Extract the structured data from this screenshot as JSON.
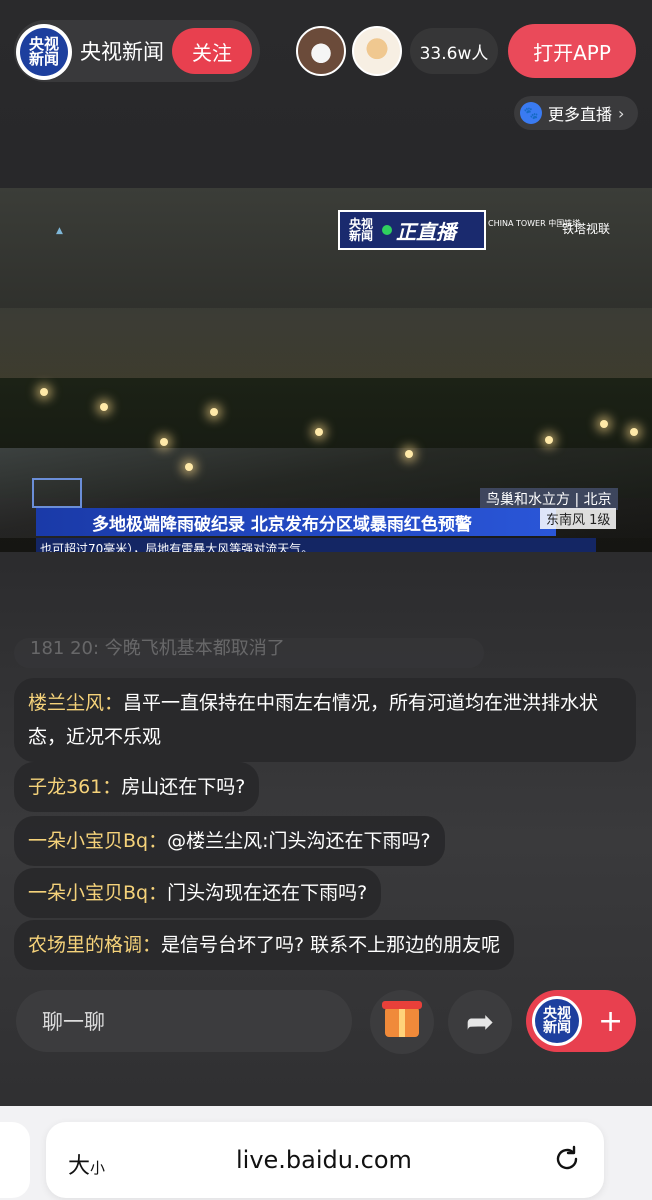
{
  "header": {
    "channel_logo": {
      "line1": "央视",
      "line2": "新闻"
    },
    "channel_name": "央视新闻",
    "follow_label": "关注",
    "viewer_count": "33.6w人",
    "open_app_label": "打开APP",
    "more_live_label": "更多直播"
  },
  "video": {
    "badge_logo": {
      "line1": "央视",
      "line2": "新闻"
    },
    "live_label": "正直播",
    "partner1": "CHINA TOWER 中国铁塔",
    "partner2": "铁塔视联",
    "headline": "多地极端降雨破纪录 北京发布分区域暴雨红色预警",
    "ticker": "也可超过70毫米），局地有雷暴大风等强对流天气。",
    "location": "鸟巢和水立方 | 北京",
    "wind": "东南风 1级"
  },
  "chat": {
    "faded_message": "181  20: 今晚飞机基本都取消了",
    "messages": [
      {
        "user": "楼兰尘风：",
        "text": "昌平一直保持在中雨左右情况，所有河道均在泄洪排水状态，近况不乐观"
      },
      {
        "user": "子龙361：",
        "text": "房山还在下吗?"
      },
      {
        "user": "一朵小宝贝Bq：",
        "text": "@楼兰尘风:门头沟还在下雨吗?"
      },
      {
        "user": "一朵小宝贝Bq：",
        "text": "门头沟现在还在下雨吗?"
      },
      {
        "user": "农场里的格调：",
        "text": "是信号台坏了吗? 联系不上那边的朋友呢"
      }
    ]
  },
  "bottom": {
    "chat_placeholder": "聊一聊",
    "follow_logo": {
      "line1": "央视",
      "line2": "新闻"
    },
    "plus": "+"
  },
  "browser": {
    "text_size_big": "大",
    "text_size_small": "小",
    "url": "live.baidu.com"
  },
  "colors": {
    "accent_red": "#e8404f",
    "username_gold": "#f5d27a",
    "cctv_blue": "#1d3f9e"
  }
}
